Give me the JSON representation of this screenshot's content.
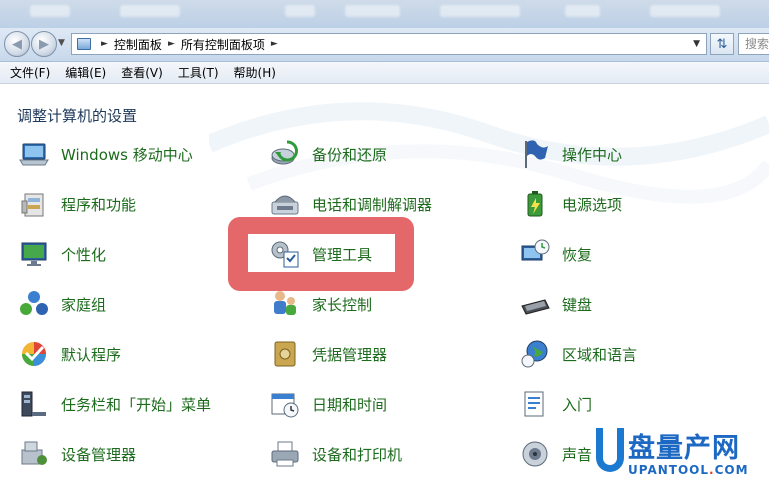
{
  "window": {
    "address_bar": {
      "crumbs": [
        "控制面板",
        "所有控制面板项"
      ]
    },
    "search": {
      "placeholder": "搜索"
    }
  },
  "menu": {
    "items": [
      "文件(F)",
      "编辑(E)",
      "查看(V)",
      "工具(T)",
      "帮助(H)"
    ]
  },
  "page": {
    "title": "调整计算机的设置"
  },
  "control_panel_items": {
    "col1": [
      "Windows 移动中心",
      "程序和功能",
      "个性化",
      "家庭组",
      "默认程序",
      "任务栏和「开始」菜单",
      "设备管理器"
    ],
    "col2": [
      "备份和还原",
      "电话和调制解调器",
      "管理工具",
      "家长控制",
      "凭据管理器",
      "日期和时间",
      "设备和打印机"
    ],
    "col3": [
      "操作中心",
      "电源选项",
      "恢复",
      "键盘",
      "区域和语言",
      "入门",
      "声音"
    ]
  },
  "highlighted_item": "管理工具",
  "colors": {
    "item_label": "#1c6b1c",
    "title": "#1e395b",
    "highlight": "#e4676a",
    "brand": "#1d68c2"
  },
  "watermark": {
    "brand_text": "盘量产网",
    "site_prefix": "UPANTOOL",
    "site_dot": ".",
    "site_suffix": "COM"
  }
}
